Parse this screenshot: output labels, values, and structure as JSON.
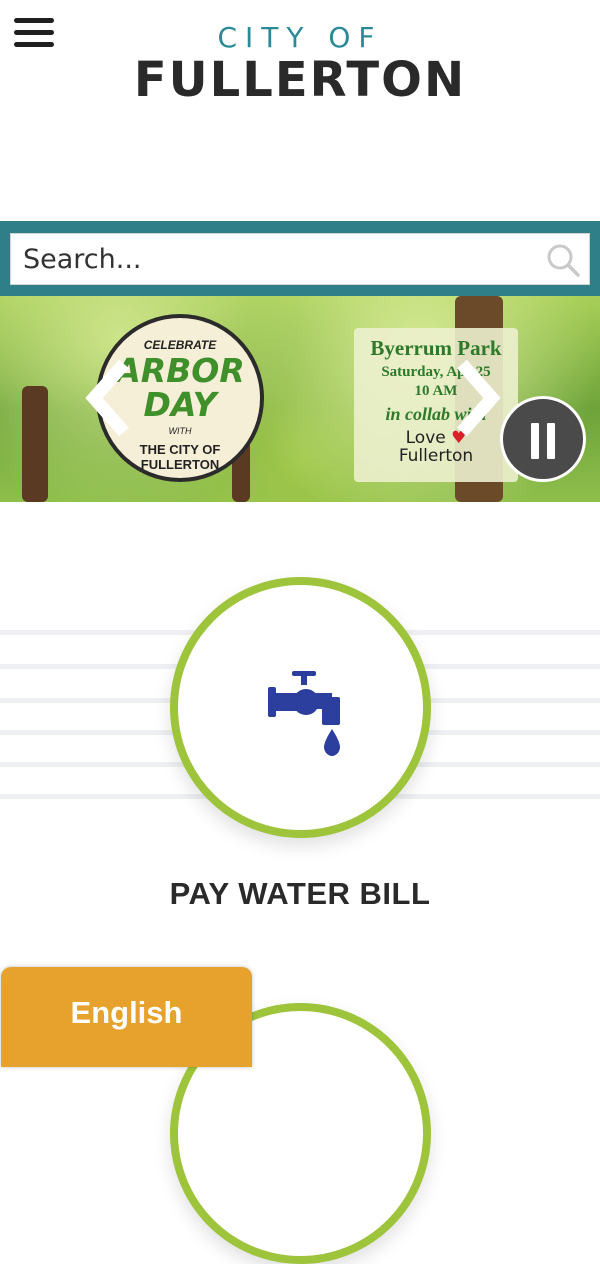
{
  "header": {
    "menu_icon": "hamburger-menu-icon",
    "logo_top": "CITY OF",
    "logo_main": "FULLERTON"
  },
  "search": {
    "placeholder": "Search...",
    "icon": "search-icon"
  },
  "slider": {
    "badge": {
      "celebrate": "CELEBRATE",
      "title_line1": "ARBOR",
      "title_line2": "DAY",
      "with": "WITH",
      "city": "THE CITY OF FULLERTON"
    },
    "event": {
      "park": "Byerrum Park",
      "date": "Saturday, Apr 25",
      "time": "10 AM",
      "collab": "in collab with",
      "love": "Love",
      "fullerton": "Fullerton"
    },
    "prev_icon": "chevron-left-icon",
    "next_icon": "chevron-right-icon",
    "pause_icon": "pause-icon"
  },
  "quick_links": [
    {
      "label": "PAY WATER BILL",
      "icon": "water-faucet-icon"
    },
    {
      "label": "",
      "icon": ""
    }
  ],
  "language": {
    "label": "English"
  },
  "colors": {
    "teal": "#2e7f88",
    "logo_teal": "#2b8a97",
    "ring_green": "#9dc43b",
    "faucet_blue": "#2d3f9e",
    "lang_orange": "#e7a22d"
  }
}
